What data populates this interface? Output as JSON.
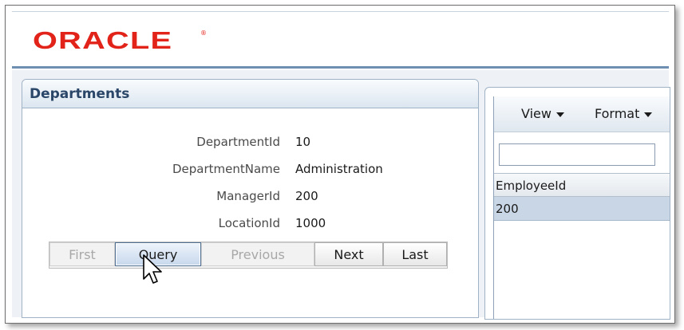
{
  "brand": {
    "logo_text": "ORACLE",
    "logo_mark": "®",
    "color": "#e2231a"
  },
  "departments": {
    "title": "Departments",
    "fields": [
      {
        "label": "DepartmentId",
        "value": "10"
      },
      {
        "label": "DepartmentName",
        "value": "Administration"
      },
      {
        "label": "ManagerId",
        "value": "200"
      },
      {
        "label": "LocationId",
        "value": "1000"
      }
    ],
    "buttons": {
      "first": "First",
      "query": "Query",
      "previous": "Previous",
      "next": "Next",
      "last": "Last"
    }
  },
  "employees": {
    "toolbar": {
      "view": "View",
      "format": "Format"
    },
    "filter_value": "",
    "column_header": "EmployeeId",
    "rows": [
      "200"
    ]
  },
  "colors": {
    "panel_title": "#2a4668",
    "selected_row": "#c9d6e6",
    "accent_border": "#6f8fb2"
  }
}
